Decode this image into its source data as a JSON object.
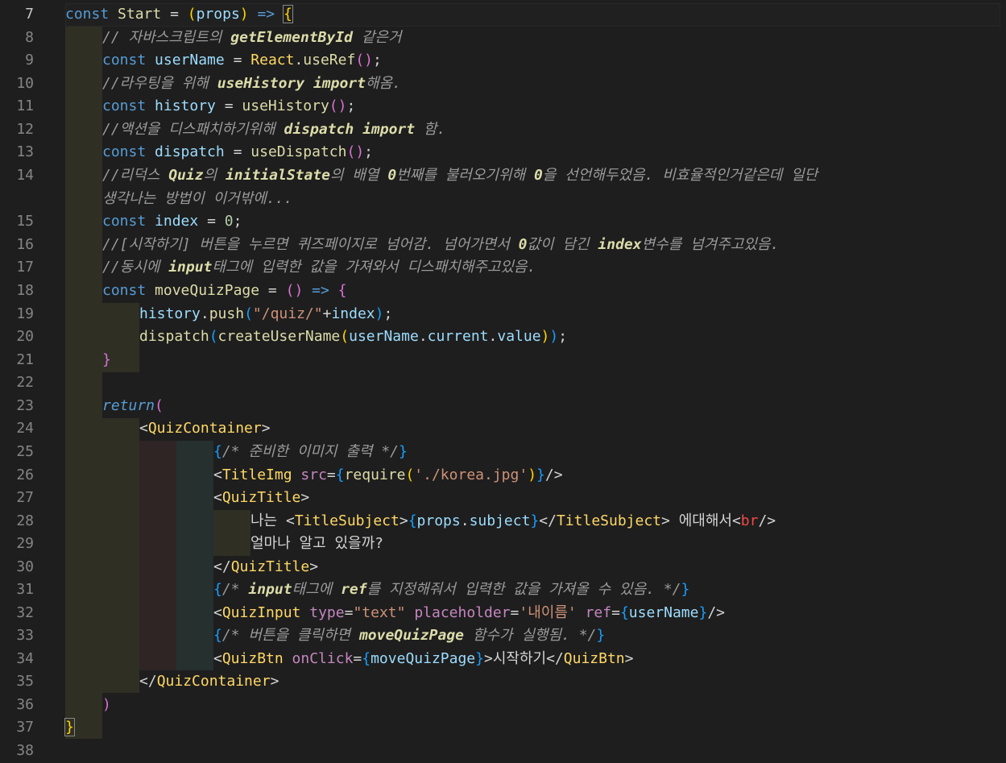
{
  "editor": {
    "background": "#1e1e1e",
    "current_line": 7,
    "lines": [
      {
        "n": "7",
        "text": "const Start = (props) => {"
      },
      {
        "n": "8",
        "text": "// 자바스크립트의 getElementById 같은거"
      },
      {
        "n": "9",
        "text": "const userName = React.useRef();"
      },
      {
        "n": "10",
        "text": "//라우팅을 위해 useHistory import해옴."
      },
      {
        "n": "11",
        "text": "const history = useHistory();"
      },
      {
        "n": "12",
        "text": "//액션을 디스패치하기위해 dispatch import 함."
      },
      {
        "n": "13",
        "text": "const dispatch = useDispatch();"
      },
      {
        "n": "14",
        "text": "//리덕스 Quiz의 initialState의 배열 0번째를 불러오기위해 0을 선언해두었음. 비효율적인거같은데 일단"
      },
      {
        "n": "",
        "text": "생각나는 방법이 이거밖에..."
      },
      {
        "n": "15",
        "text": "const index = 0;"
      },
      {
        "n": "16",
        "text": "//[시작하기] 버튼을 누르면 퀴즈페이지로 넘어감. 넘어가면서 0값이 담긴 index변수를 넘겨주고있음."
      },
      {
        "n": "17",
        "text": "//동시에 input태그에 입력한 값을 가져와서 디스패치해주고있음."
      },
      {
        "n": "18",
        "text": "const moveQuizPage = () => {"
      },
      {
        "n": "19",
        "text": "history.push(\"/quiz/\"+index);"
      },
      {
        "n": "20",
        "text": "dispatch(createUserName(userName.current.value));"
      },
      {
        "n": "21",
        "text": "}"
      },
      {
        "n": "22",
        "text": ""
      },
      {
        "n": "23",
        "text": "return("
      },
      {
        "n": "24",
        "text": "<QuizContainer>"
      },
      {
        "n": "25",
        "text": "{/* 준비한 이미지 출력 */}"
      },
      {
        "n": "26",
        "text": "<TitleImg src={require('./korea.jpg')}/>"
      },
      {
        "n": "27",
        "text": "<QuizTitle>"
      },
      {
        "n": "28",
        "text": "나는 <TitleSubject>{props.subject}</TitleSubject> 에대해서<br/>"
      },
      {
        "n": "29",
        "text": "얼마나 알고 있을까?"
      },
      {
        "n": "30",
        "text": "</QuizTitle>"
      },
      {
        "n": "31",
        "text": "{/* input태그에 ref를 지정해줘서 입력한 값을 가져올 수 있음. */}"
      },
      {
        "n": "32",
        "text": "<QuizInput type=\"text\" placeholder='내이름' ref={userName}/>"
      },
      {
        "n": "33",
        "text": "{/* 버튼을 클릭하면 moveQuizPage 함수가 실행됨. */}"
      },
      {
        "n": "34",
        "text": "<QuizBtn onClick={moveQuizPage}>시작하기</QuizBtn>"
      },
      {
        "n": "35",
        "text": "</QuizContainer>"
      },
      {
        "n": "36",
        "text": ")"
      },
      {
        "n": "37",
        "text": "}"
      },
      {
        "n": "38",
        "text": ""
      }
    ]
  }
}
